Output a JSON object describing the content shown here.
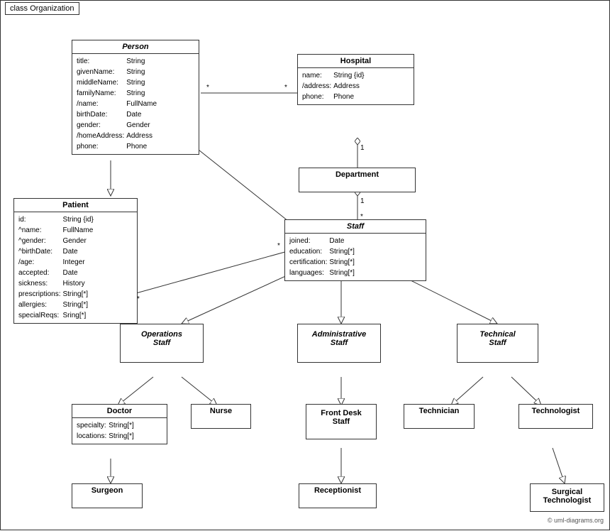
{
  "diagram": {
    "title": "class Organization",
    "copyright": "© uml-diagrams.org",
    "classes": {
      "person": {
        "name": "Person",
        "italic": true,
        "attributes": [
          [
            "title:",
            "String"
          ],
          [
            "givenName:",
            "String"
          ],
          [
            "middleName:",
            "String"
          ],
          [
            "familyName:",
            "String"
          ],
          [
            "/name:",
            "FullName"
          ],
          [
            "birthDate:",
            "Date"
          ],
          [
            "gender:",
            "Gender"
          ],
          [
            "/homeAddress:",
            "Address"
          ],
          [
            "phone:",
            "Phone"
          ]
        ]
      },
      "hospital": {
        "name": "Hospital",
        "italic": false,
        "attributes": [
          [
            "name:",
            "String {id}"
          ],
          [
            "/address:",
            "Address"
          ],
          [
            "phone:",
            "Phone"
          ]
        ]
      },
      "patient": {
        "name": "Patient",
        "italic": false,
        "attributes": [
          [
            "id:",
            "String {id}"
          ],
          [
            "^name:",
            "FullName"
          ],
          [
            "^gender:",
            "Gender"
          ],
          [
            "^birthDate:",
            "Date"
          ],
          [
            "/age:",
            "Integer"
          ],
          [
            "accepted:",
            "Date"
          ],
          [
            "sickness:",
            "History"
          ],
          [
            "prescriptions:",
            "String[*]"
          ],
          [
            "allergies:",
            "String[*]"
          ],
          [
            "specialReqs:",
            "Sring[*]"
          ]
        ]
      },
      "department": {
        "name": "Department",
        "italic": false,
        "attributes": []
      },
      "staff": {
        "name": "Staff",
        "italic": true,
        "attributes": [
          [
            "joined:",
            "Date"
          ],
          [
            "education:",
            "String[*]"
          ],
          [
            "certification:",
            "String[*]"
          ],
          [
            "languages:",
            "String[*]"
          ]
        ]
      },
      "operations_staff": {
        "name": "Operations\nStaff",
        "italic": true,
        "attributes": []
      },
      "administrative_staff": {
        "name": "Administrative\nStaff",
        "italic": true,
        "attributes": []
      },
      "technical_staff": {
        "name": "Technical\nStaff",
        "italic": true,
        "attributes": []
      },
      "doctor": {
        "name": "Doctor",
        "italic": false,
        "attributes": [
          [
            "specialty:",
            "String[*]"
          ],
          [
            "locations:",
            "String[*]"
          ]
        ]
      },
      "nurse": {
        "name": "Nurse",
        "italic": false,
        "attributes": []
      },
      "front_desk_staff": {
        "name": "Front Desk\nStaff",
        "italic": false,
        "attributes": []
      },
      "technician": {
        "name": "Technician",
        "italic": false,
        "attributes": []
      },
      "technologist": {
        "name": "Technologist",
        "italic": false,
        "attributes": []
      },
      "surgeon": {
        "name": "Surgeon",
        "italic": false,
        "attributes": []
      },
      "receptionist": {
        "name": "Receptionist",
        "italic": false,
        "attributes": []
      },
      "surgical_technologist": {
        "name": "Surgical\nTechnologist",
        "italic": false,
        "attributes": []
      }
    }
  }
}
